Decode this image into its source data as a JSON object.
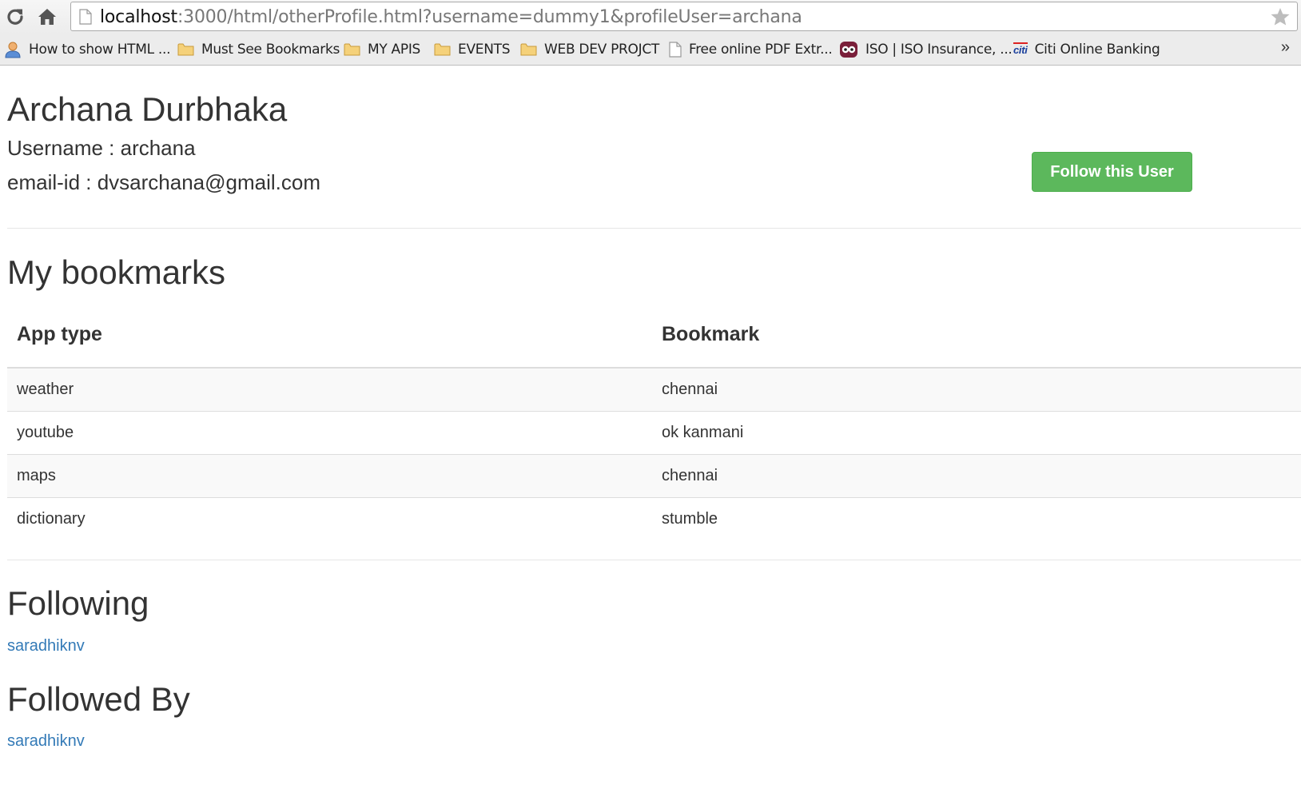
{
  "browser": {
    "url_host": "localhost",
    "url_rest": ":3000/html/otherProfile.html?username=dummy1&profileUser=archana",
    "bookmarks": [
      {
        "label": "How to show HTML ...",
        "icon": "user-avatar-icon"
      },
      {
        "label": "Must See Bookmarks",
        "icon": "folder-icon"
      },
      {
        "label": "MY APIS",
        "icon": "folder-icon"
      },
      {
        "label": "EVENTS",
        "icon": "folder-icon"
      },
      {
        "label": "WEB DEV PROJCT",
        "icon": "folder-icon"
      },
      {
        "label": "Free online PDF Extr...",
        "icon": "page-icon"
      },
      {
        "label": "ISO | ISO Insurance, ...",
        "icon": "iso-logo-icon"
      },
      {
        "label": "Citi Online Banking",
        "icon": "citi-logo-icon",
        "icon_text": "citi"
      }
    ],
    "more_label": "»"
  },
  "profile": {
    "name": "Archana Durbhaka",
    "username_line": "Username : archana",
    "email_line": "email-id : dvsarchana@gmail.com",
    "follow_button_label": "Follow this User"
  },
  "bookmarks_section": {
    "title": "My bookmarks",
    "columns": [
      "App type",
      "Bookmark"
    ],
    "rows": [
      [
        "weather",
        "chennai"
      ],
      [
        "youtube",
        "ok kanmani"
      ],
      [
        "maps",
        "chennai"
      ],
      [
        "dictionary",
        "stumble"
      ]
    ]
  },
  "following": {
    "title": "Following",
    "users": [
      "saradhiknv"
    ]
  },
  "followed_by": {
    "title": "Followed By",
    "users": [
      "saradhiknv"
    ]
  },
  "colors": {
    "follow_button": "#5cb85c",
    "link": "#337ab7",
    "text": "#333333"
  }
}
